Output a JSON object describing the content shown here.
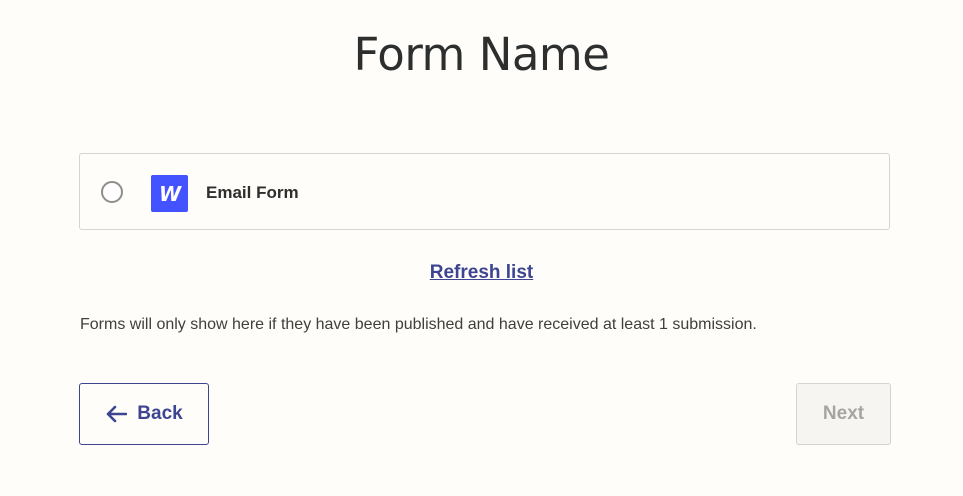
{
  "header": {
    "title": "Form Name"
  },
  "options": [
    {
      "label": "Email Form",
      "app_icon": "webflow-logo-icon",
      "app_icon_letter": "W",
      "selected": false
    }
  ],
  "refresh": {
    "label": "Refresh list"
  },
  "help_text": "Forms will only show here if they have been published and have received at least 1 submission.",
  "buttons": {
    "back_label": "Back",
    "back_icon": "arrow-left-icon",
    "next_label": "Next",
    "next_disabled": true
  },
  "colors": {
    "background": "#fffdf9",
    "accent": "#3d4592",
    "app_logo": "#4353ff",
    "disabled_text": "#a8a5a0"
  }
}
